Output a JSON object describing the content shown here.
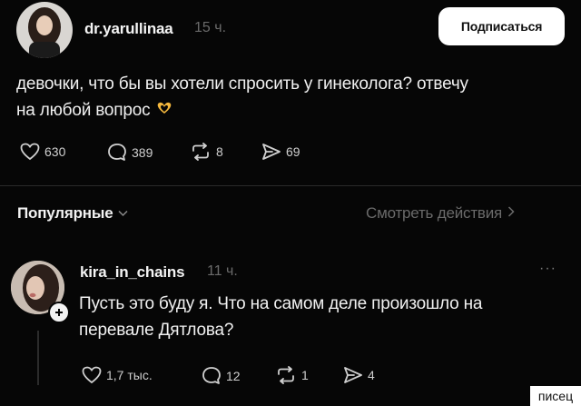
{
  "post": {
    "username": "dr.yarullinaa",
    "time": "15 ч.",
    "subscribe_label": "Подписаться",
    "text_line1": "девочки, что бы вы хотели спросить у гинеколога? отвечу",
    "text_line2": "на любой вопрос",
    "likes": "630",
    "comments": "389",
    "reposts": "8",
    "shares": "69"
  },
  "filter": {
    "sort_label": "Популярные",
    "view_actions_label": "Смотреть действия"
  },
  "reply": {
    "username": "kira_in_chains",
    "time": "11 ч.",
    "more": "···",
    "text_line1": "Пусть это буду я. Что на самом деле произошло на",
    "text_line2": "перевале Дятлова?",
    "likes": "1,7 тыс.",
    "comments": "12",
    "reposts": "1",
    "shares": "4"
  },
  "watermark": "писец"
}
